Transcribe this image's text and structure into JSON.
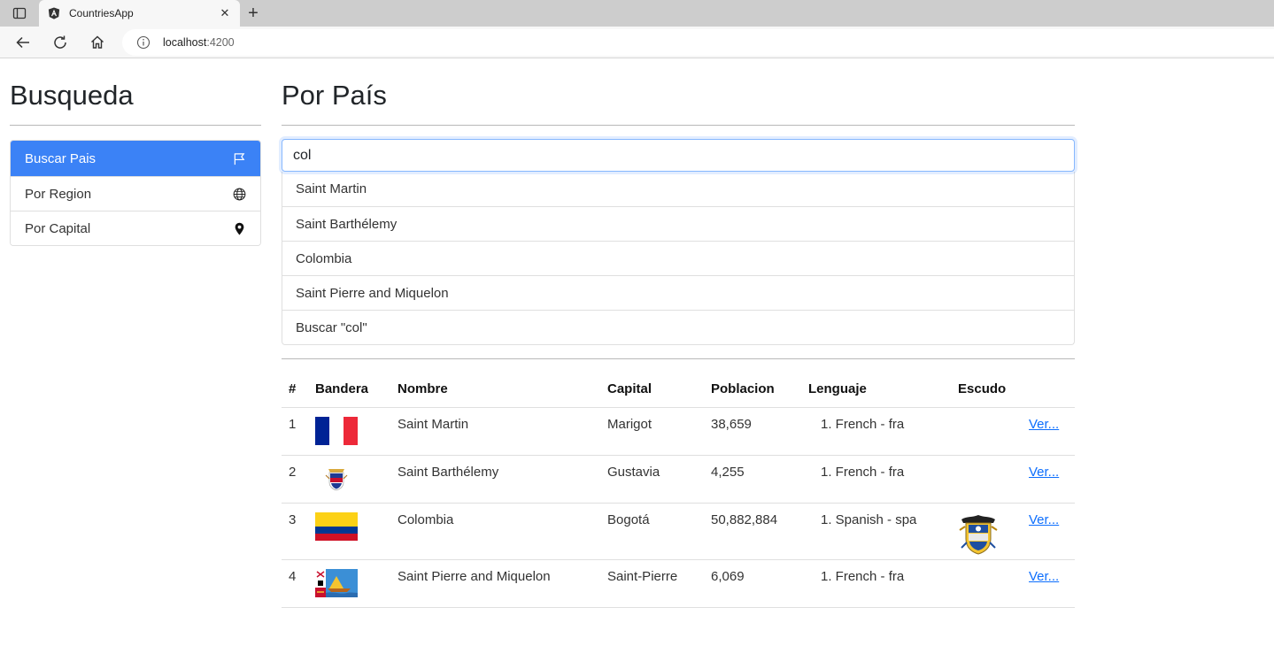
{
  "browser": {
    "tab_title": "CountriesApp",
    "address_host": "localhost",
    "address_port": ":4200"
  },
  "sidebar": {
    "title": "Busqueda",
    "items": [
      {
        "label": "Buscar Pais",
        "icon": "flag-icon",
        "active": true
      },
      {
        "label": "Por Region",
        "icon": "globe-icon",
        "active": false
      },
      {
        "label": "Por Capital",
        "icon": "location-pin-icon",
        "active": false
      }
    ]
  },
  "main": {
    "title": "Por País",
    "search": {
      "value": "col",
      "placeholder": ""
    },
    "suggestions": [
      "Saint Martin",
      "Saint Barthélemy",
      "Colombia",
      "Saint Pierre and Miquelon",
      "Buscar \"col\""
    ]
  },
  "table": {
    "headers": [
      "#",
      "Bandera",
      "Nombre",
      "Capital",
      "Poblacion",
      "Lenguaje",
      "Escudo",
      ""
    ],
    "rows": [
      {
        "num": "1",
        "flag": "flag-france",
        "name": "Saint Martin",
        "capital": "Marigot",
        "population": "38,659",
        "language": "1. French - fra",
        "coat": "",
        "link": "Ver..."
      },
      {
        "num": "2",
        "flag": "flag-saint-barthelemy",
        "name": "Saint Barthélemy",
        "capital": "Gustavia",
        "population": "4,255",
        "language": "1. French - fra",
        "coat": "",
        "link": "Ver..."
      },
      {
        "num": "3",
        "flag": "flag-colombia",
        "name": "Colombia",
        "capital": "Bogotá",
        "population": "50,882,884",
        "language": "1. Spanish - spa",
        "coat": "coat-of-arms-colombia",
        "link": "Ver..."
      },
      {
        "num": "4",
        "flag": "flag-saint-pierre-miquelon",
        "name": "Saint Pierre and Miquelon",
        "capital": "Saint-Pierre",
        "population": "6,069",
        "language": "1. French - fra",
        "coat": "",
        "link": "Ver..."
      }
    ]
  },
  "colors": {
    "accent": "#3b82f6",
    "link": "#0d6efd"
  }
}
